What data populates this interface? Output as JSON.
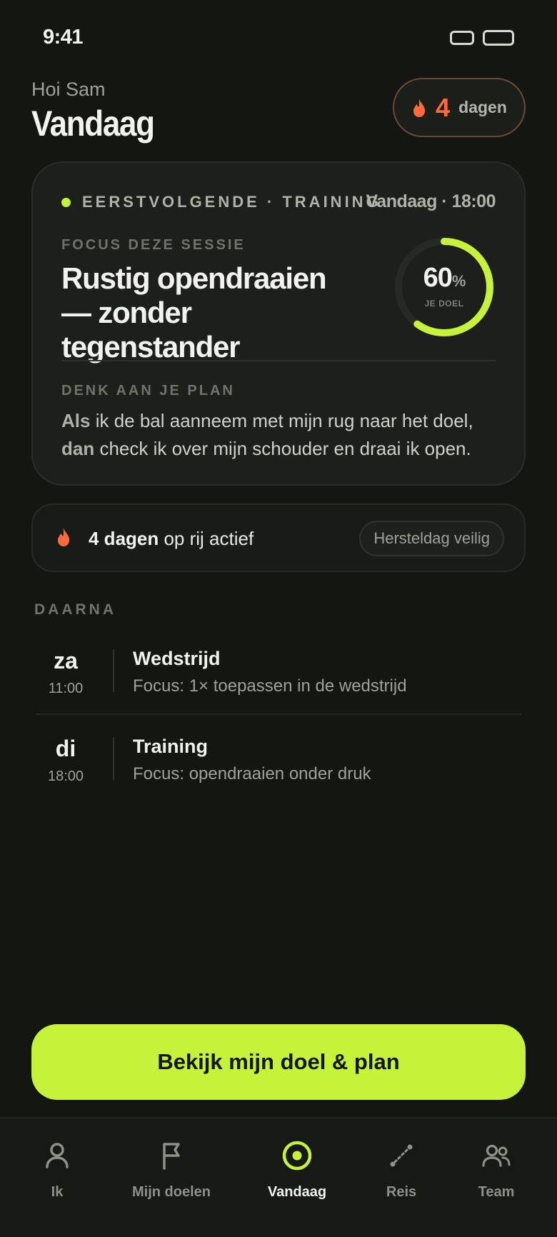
{
  "status": {
    "time": "9:41"
  },
  "header": {
    "greeting": "Hoi Sam",
    "title": "Vandaag",
    "streak_count": "4",
    "streak_label": "dagen"
  },
  "next_session": {
    "kicker": "EERSTVOLGENDE · TRAINING",
    "when": "Vandaag · 18:00",
    "focus_label": "FOCUS DEZE SESSIE",
    "focus": "Rustig opendraaien — zonder tegenstander",
    "progress_value": "60",
    "progress_unit": "%",
    "progress_fraction": 0.6,
    "progress_caption": "JE DOEL",
    "plan_label": "DENK AAN JE PLAN",
    "plan_if_word": "Als",
    "plan_if_text": " ik de bal aanneem met mijn rug naar het doel,",
    "plan_then_word": "dan",
    "plan_then_text": " check ik over mijn schouder en draai ik open."
  },
  "streak_row": {
    "bold": "4 dagen",
    "rest": " op rij actief",
    "chip": "Hersteldag veilig"
  },
  "upcoming": {
    "label": "DAARNA",
    "items": [
      {
        "day": "za",
        "time": "11:00",
        "name": "Wedstrijd",
        "focus": "Focus: 1× toepassen in de wedstrijd"
      },
      {
        "day": "di",
        "time": "18:00",
        "name": "Training",
        "focus": "Focus: opendraaien onder druk"
      }
    ]
  },
  "cta": {
    "label": "Bekijk mijn doel & plan"
  },
  "nav": [
    {
      "label": "Ik",
      "icon": "person-icon"
    },
    {
      "label": "Mijn doelen",
      "icon": "flag-icon"
    },
    {
      "label": "Vandaag",
      "icon": "target-icon",
      "active": true
    },
    {
      "label": "Reis",
      "icon": "journey-icon"
    },
    {
      "label": "Team",
      "icon": "team-icon"
    }
  ],
  "colors": {
    "accent": "#c6f23a",
    "streak": "#ff6a3a",
    "background": "#131611",
    "card": "#1c1f1b"
  }
}
